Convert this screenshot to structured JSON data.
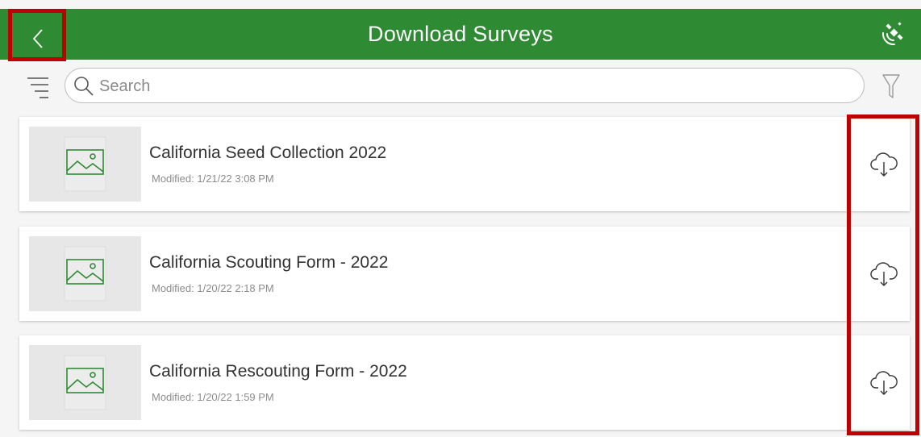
{
  "header": {
    "title": "Download Surveys",
    "back_icon": "chevron-left-icon",
    "status_icon": "satellite-icon",
    "background_color": "#2e8a33"
  },
  "search": {
    "placeholder": "Search",
    "value": ""
  },
  "toolbar": {
    "sort_icon": "sort-list-icon",
    "search_icon": "magnifier-icon",
    "filter_icon": "filter-funnel-icon"
  },
  "surveys": [
    {
      "title": "California Seed Collection 2022",
      "modified": "Modified: 1/21/22 3:08 PM",
      "action_icon": "cloud-download-icon"
    },
    {
      "title": "California Scouting Form - 2022",
      "modified": "Modified: 1/20/22 2:18 PM",
      "action_icon": "cloud-download-icon"
    },
    {
      "title": "California Rescouting Form - 2022",
      "modified": "Modified: 1/20/22 1:59 PM",
      "action_icon": "cloud-download-icon"
    }
  ],
  "highlight_color": "#c00000"
}
